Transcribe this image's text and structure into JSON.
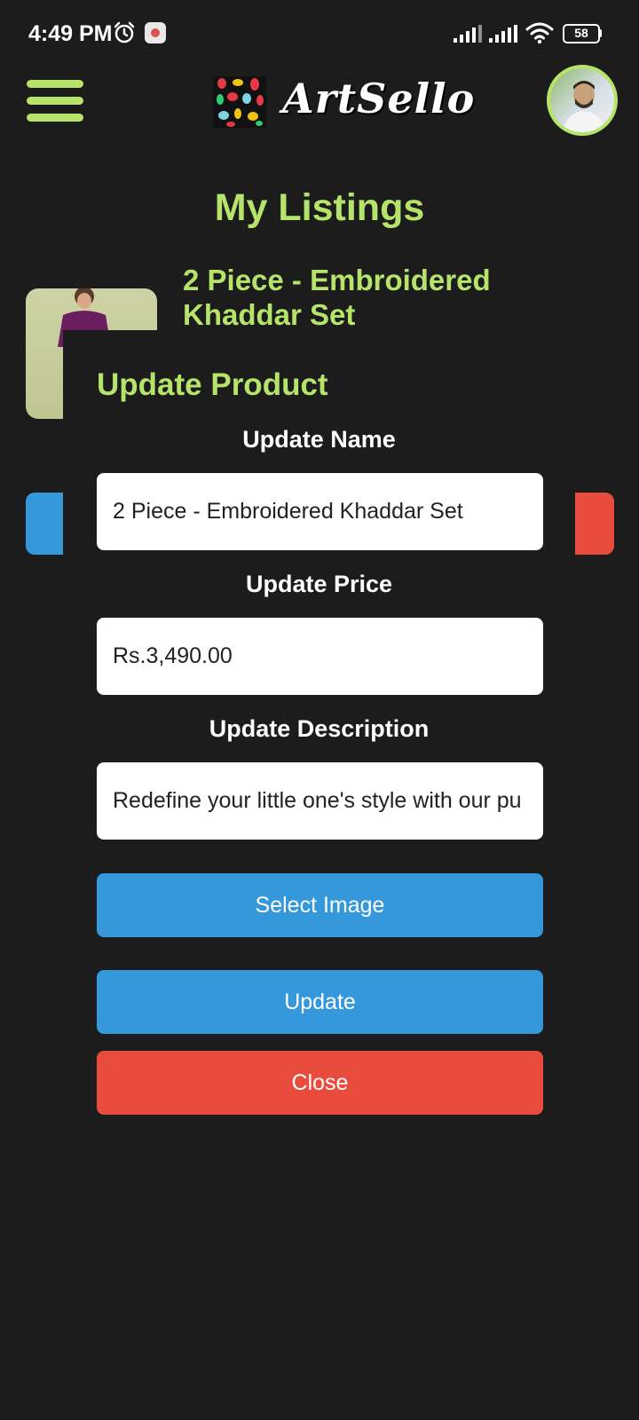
{
  "status_bar": {
    "time": "4:49 PM",
    "battery": "58"
  },
  "header": {
    "logo_text": "ArtSello",
    "icons": [
      "menu-icon",
      "logo-icon",
      "avatar"
    ]
  },
  "page": {
    "title": "My Listings"
  },
  "listing": {
    "title": "2 Piece - Embroidered Khaddar Set"
  },
  "modal": {
    "title": "Update Product",
    "name_label": "Update Name",
    "name_value": "2 Piece - Embroidered Khaddar Set",
    "price_label": "Update Price",
    "price_value": "Rs.3,490.00",
    "description_label": "Update Description",
    "description_value": "Redefine your little one's style with our pu",
    "select_image_label": "Select Image",
    "update_label": "Update",
    "close_label": "Close"
  },
  "colors": {
    "accent": "#b6e36a",
    "background": "#1c1c1c",
    "primary_button": "#3498db",
    "danger_button": "#e74c3c"
  }
}
